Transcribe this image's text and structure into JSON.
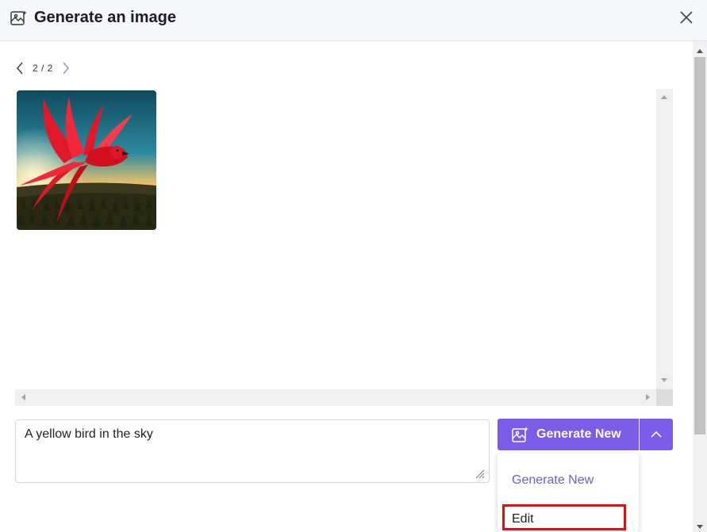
{
  "dialog": {
    "title": "Generate an image",
    "title_icon": "image-sparkle-icon",
    "close_icon": "close-icon"
  },
  "pager": {
    "count": "2 / 2",
    "prev_icon": "chevron-left-icon",
    "next_icon": "chevron-right-icon"
  },
  "gallery": {
    "image_description": "red bird flying over forest at sunset"
  },
  "prompt": {
    "value": "A yellow bird in the sky"
  },
  "actions": {
    "generate_label": "Generate New",
    "dropdown_icon": "chevron-up-icon"
  },
  "menu": {
    "items": [
      "Generate New",
      "Edit"
    ]
  },
  "colors": {
    "accent": "#7b5ce8",
    "menu_link": "#6b5ad6",
    "highlight": "#e01010"
  }
}
